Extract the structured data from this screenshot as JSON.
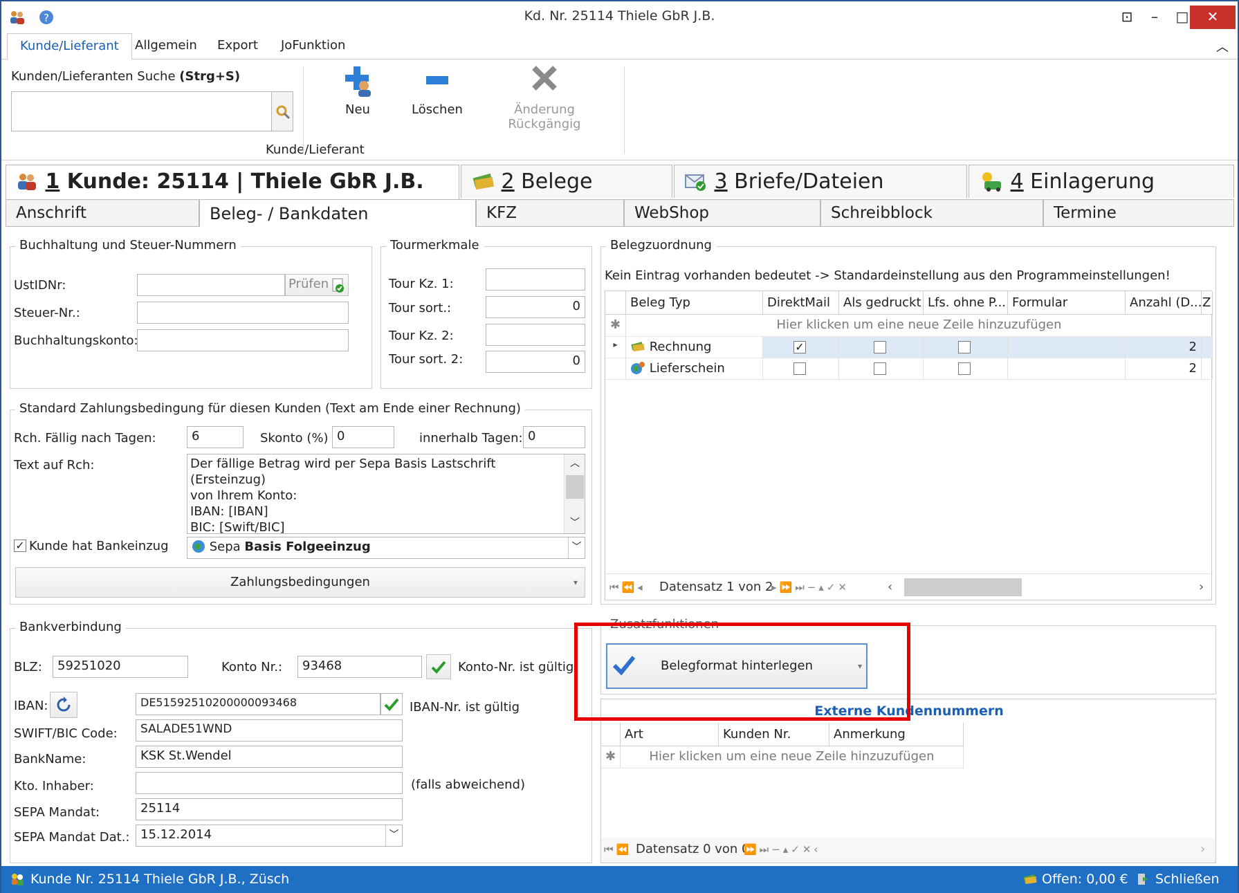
{
  "window": {
    "title": "Kd. Nr. 25114 Thiele GbR J.B.",
    "buttons": {
      "restore": "⊡",
      "minimize": "–",
      "maximize": "□",
      "close": "✕"
    }
  },
  "ribbon_tabs": [
    "Kunde/Lieferant",
    "Allgemein",
    "Export",
    "JoFunktion"
  ],
  "ribbon": {
    "search_label": "Kunden/Lieferanten Suche",
    "search_shortcut": "(Strg+S)",
    "search_value": "",
    "group_label": "Kunde/Lieferant",
    "new_label": "Neu",
    "delete_label": "Löschen",
    "undo_label": "Änderung Rückgängig"
  },
  "main_tabs": [
    {
      "num": "1",
      "label": " Kunde: 25114 | Thiele GbR J.B."
    },
    {
      "num": "2",
      "label": " Belege"
    },
    {
      "num": "3",
      "label": " Briefe/Dateien"
    },
    {
      "num": "4",
      "label": " Einlagerung"
    }
  ],
  "sub_tabs": [
    "Anschrift",
    "Beleg- / Bankdaten",
    "KFZ",
    "WebShop",
    "Schreibblock",
    "Termine"
  ],
  "tax": {
    "title": "Buchhaltung und Steuer-Nummern",
    "ustid_label": "UstIDNr:",
    "ustid_value": "",
    "check_label": "Prüfen",
    "steuer_label": "Steuer-Nr.:",
    "steuer_value": "",
    "konto_label": "Buchhaltungskonto:",
    "konto_value": ""
  },
  "tour": {
    "title": "Tourmerkmale",
    "kz1_label": "Tour Kz. 1:",
    "kz1_value": "",
    "sort1_label": "Tour sort.:",
    "sort1_value": "0",
    "kz2_label": "Tour Kz. 2:",
    "kz2_value": "",
    "sort2_label": "Tour sort. 2:",
    "sort2_value": "0"
  },
  "payment": {
    "title": "Standard Zahlungsbedingung für diesen Kunden (Text am Ende einer Rechnung)",
    "due_label": "Rch. Fällig nach Tagen:",
    "due_value": "6",
    "skonto_label": "Skonto (%)",
    "skonto_value": "0",
    "within_label": "innerhalb Tagen:",
    "within_value": "0",
    "text_label": "Text auf Rch:",
    "text_lines": [
      "Der fällige Betrag wird per Sepa Basis Lastschrift (Ersteinzug)",
      "von Ihrem Konto:",
      "IBAN: [IBAN]",
      "BIC: [Swift/BIC]"
    ],
    "bank_collect_label": "Kunde hat Bankeinzug",
    "sepa_prefix": "Sepa ",
    "sepa_bold": "Basis Folgeeinzug",
    "terms_button": "Zahlungsbedingungen"
  },
  "bank": {
    "title": "Bankverbindung",
    "blz_label": "BLZ:",
    "blz_value": "59251020",
    "kontonr_label": "Konto Nr.:",
    "kontonr_value": "93468",
    "konto_valid": "Konto-Nr. ist gültig",
    "iban_label": "IBAN:",
    "iban_value": "DE51592510200000093468",
    "iban_valid": "IBAN-Nr. ist gültig",
    "swift_label": "SWIFT/BIC Code:",
    "swift_value": "SALADE51WND",
    "bankname_label": "BankName:",
    "bankname_value": "KSK St.Wendel",
    "holder_label": "Kto. Inhaber:",
    "holder_value": "",
    "holder_hint": "(falls abweichend)",
    "mandat_label": "SEPA Mandat:",
    "mandat_value": "25114",
    "mandat_date_label": "SEPA Mandat Dat.:",
    "mandat_date_value": "15.12.2014"
  },
  "beleg": {
    "title": "Belegzuordnung",
    "info": "Kein Eintrag vorhanden bedeutet -> Standardeinstellung aus den Programmeinstellungen!",
    "columns": [
      "Beleg Typ",
      "DirektMail",
      "Als gedruckt",
      "Lfs. ohne P...",
      "Formular",
      "Anzahl (D...",
      "Z"
    ],
    "new_row": "Hier klicken um eine neue Zeile hinzuzufügen",
    "rows": [
      {
        "type": "Rechnung",
        "direktmail": true,
        "gedruckt": false,
        "lfs": false,
        "formular": "",
        "anzahl": "2"
      },
      {
        "type": "Lieferschein",
        "direktmail": false,
        "gedruckt": false,
        "lfs": false,
        "formular": "",
        "anzahl": "2"
      }
    ],
    "nav_text": "Datensatz 1 von 2"
  },
  "extra": {
    "title": "Zusatzfunktionen",
    "button": "Belegformat hinterlegen"
  },
  "ext": {
    "title": "Externe Kundennummern",
    "columns": [
      "Art",
      "Kunden Nr.",
      "Anmerkung"
    ],
    "new_row": "Hier klicken um eine neue Zeile hinzuzufügen",
    "nav_text": "Datensatz 0 von 0"
  },
  "status": {
    "left": "Kunde Nr. 25114 Thiele GbR J.B., Züsch",
    "offen": "Offen: 0,00 €",
    "close": "Schließen"
  },
  "colors": {
    "accent": "#1a5fb4",
    "statusbar": "#1f6fc5",
    "highlight": "#e40000",
    "check_green": "#2a9d2a"
  }
}
